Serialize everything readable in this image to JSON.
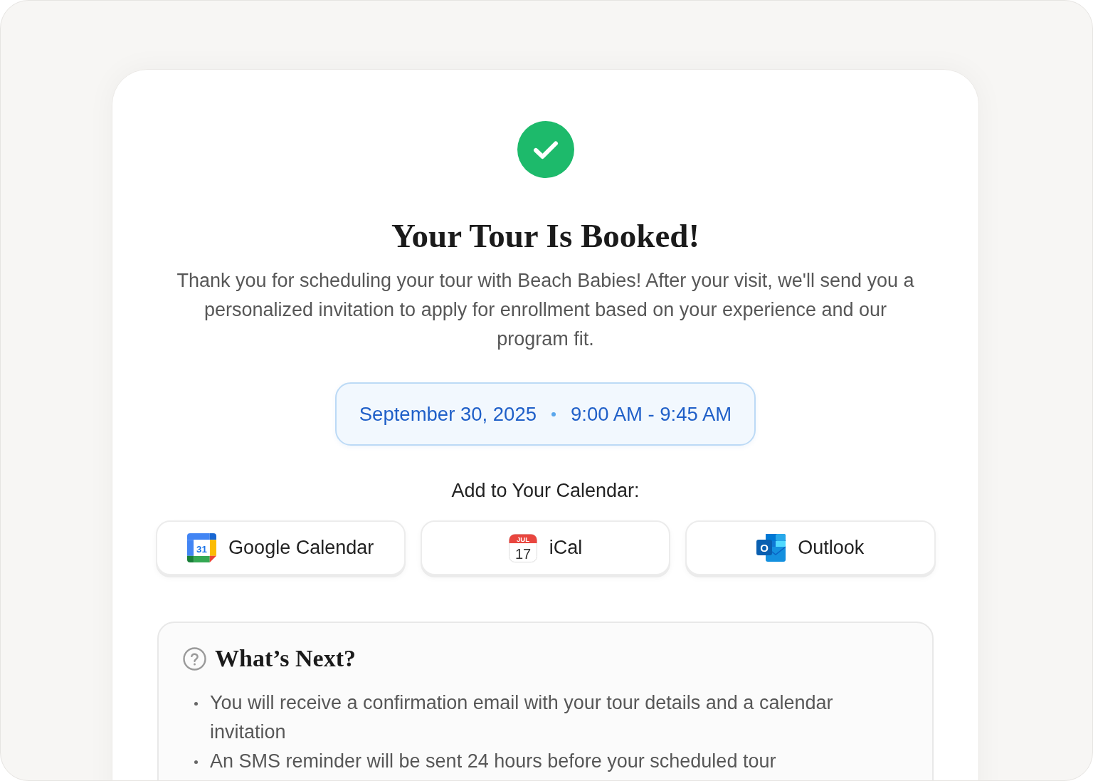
{
  "title": "Your Tour Is Booked!",
  "message": "Thank you for scheduling your tour with Beach Babies! After your visit, we'll send you a personalized invitation to apply for enrollment based on your experience and our program fit.",
  "appointment": {
    "date": "September 30, 2025",
    "time": "9:00 AM - 9:45 AM"
  },
  "calendar": {
    "label": "Add to Your Calendar:",
    "options": [
      {
        "kind": "google",
        "label": "Google Calendar",
        "icon_text": "31"
      },
      {
        "kind": "ical",
        "label": "iCal",
        "icon_month": "JUL",
        "icon_day": "17"
      },
      {
        "kind": "outlook",
        "label": "Outlook",
        "icon_text": "O"
      }
    ]
  },
  "next_steps": {
    "title": "What’s Next?",
    "items": [
      "You will receive a confirmation email with your tour details and a calendar invitation",
      "An SMS reminder will be sent 24 hours before your scheduled tour"
    ]
  }
}
